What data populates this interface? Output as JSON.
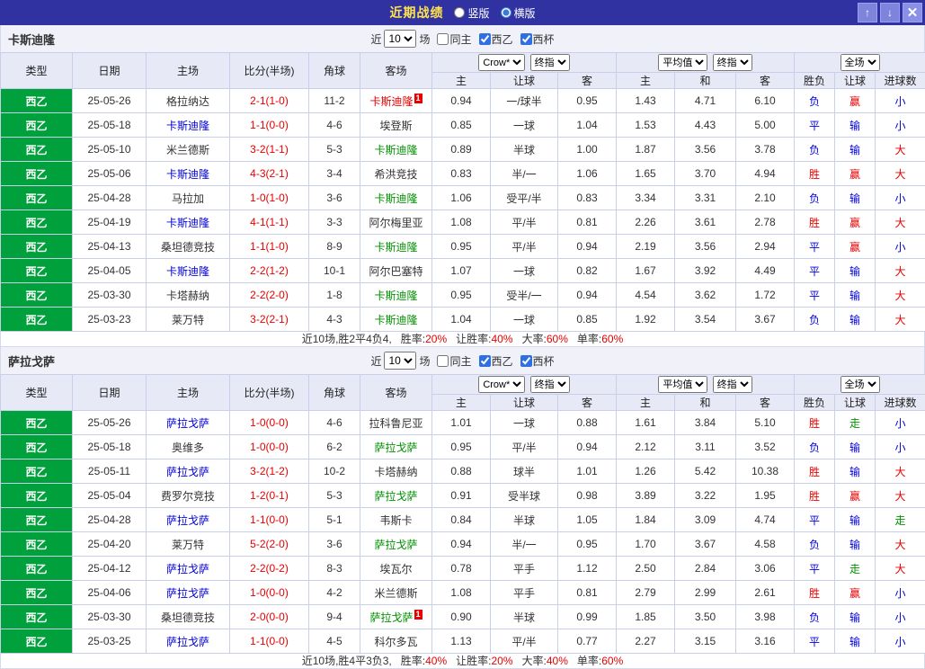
{
  "topbar": {
    "title": "近期战绩",
    "view_options": [
      {
        "label": "竖版",
        "selected": false
      },
      {
        "label": "横版",
        "selected": true
      }
    ],
    "up_label": "↑",
    "down_label": "↓",
    "close_label": "✕"
  },
  "colors": {
    "topbar_bg": "#3032a2",
    "league_cell_bg": "#00a13c",
    "positive_red": "#e60000",
    "negative_blue": "#0000d8",
    "push_green": "#009100",
    "home_team_blue": "#0000d8",
    "away_team_green": "#009100",
    "score_red": "#e60000",
    "header_bg": "#e8e9f6"
  },
  "table_headers": {
    "type": "类型",
    "date": "日期",
    "home": "主场",
    "score": "比分(半场)",
    "corner": "角球",
    "away": "客场",
    "odds_home": "主",
    "odds_handicap": "让球",
    "odds_away": "客",
    "avg_home": "主",
    "avg_draw": "和",
    "avg_away": "客",
    "result": "胜负",
    "handicap_result": "让球",
    "goals": "进球数"
  },
  "sections": [
    {
      "team": "卡斯迪隆",
      "filter": {
        "prefix": "近",
        "count": "10",
        "suffix": "场",
        "checkboxes": [
          {
            "label": "同主",
            "checked": false
          },
          {
            "label": "西乙",
            "checked": true
          },
          {
            "label": "西杯",
            "checked": true
          }
        ]
      },
      "selects": {
        "odds_source": "Crow*",
        "odds_final": "终指",
        "avg_source": "平均值",
        "avg_final": "终指",
        "scope": "全场"
      },
      "rows": [
        {
          "league": "西乙",
          "date": "25-05-26",
          "home": {
            "name": "格拉纳达",
            "color": "black"
          },
          "score": "2-1(1-0)",
          "corner": "11-2",
          "away": {
            "name": "卡斯迪隆",
            "color": "red",
            "badge": "1"
          },
          "odds": [
            "0.94",
            "一/球半",
            "0.95"
          ],
          "avg": [
            "1.43",
            "4.71",
            "6.10"
          ],
          "results": [
            {
              "text": "负",
              "color": "blue"
            },
            {
              "text": "赢",
              "color": "red"
            },
            {
              "text": "小",
              "color": "blue"
            }
          ]
        },
        {
          "league": "西乙",
          "date": "25-05-18",
          "home": {
            "name": "卡斯迪隆",
            "color": "blue"
          },
          "score": "1-1(0-0)",
          "corner": "4-6",
          "away": {
            "name": "埃登斯",
            "color": "black"
          },
          "odds": [
            "0.85",
            "一球",
            "1.04"
          ],
          "avg": [
            "1.53",
            "4.43",
            "5.00"
          ],
          "results": [
            {
              "text": "平",
              "color": "blue"
            },
            {
              "text": "输",
              "color": "blue"
            },
            {
              "text": "小",
              "color": "blue"
            }
          ]
        },
        {
          "league": "西乙",
          "date": "25-05-10",
          "home": {
            "name": "米兰德斯",
            "color": "black"
          },
          "score": "3-2(1-1)",
          "corner": "5-3",
          "away": {
            "name": "卡斯迪隆",
            "color": "green"
          },
          "odds": [
            "0.89",
            "半球",
            "1.00"
          ],
          "avg": [
            "1.87",
            "3.56",
            "3.78"
          ],
          "results": [
            {
              "text": "负",
              "color": "blue"
            },
            {
              "text": "输",
              "color": "blue"
            },
            {
              "text": "大",
              "color": "red"
            }
          ]
        },
        {
          "league": "西乙",
          "date": "25-05-06",
          "home": {
            "name": "卡斯迪隆",
            "color": "blue"
          },
          "score": "4-3(2-1)",
          "corner": "3-4",
          "away": {
            "name": "希洪竞技",
            "color": "black"
          },
          "odds": [
            "0.83",
            "半/一",
            "1.06"
          ],
          "avg": [
            "1.65",
            "3.70",
            "4.94"
          ],
          "results": [
            {
              "text": "胜",
              "color": "red"
            },
            {
              "text": "赢",
              "color": "red"
            },
            {
              "text": "大",
              "color": "red"
            }
          ]
        },
        {
          "league": "西乙",
          "date": "25-04-28",
          "home": {
            "name": "马拉加",
            "color": "black"
          },
          "score": "1-0(1-0)",
          "corner": "3-6",
          "away": {
            "name": "卡斯迪隆",
            "color": "green"
          },
          "odds": [
            "1.06",
            "受平/半",
            "0.83"
          ],
          "avg": [
            "3.34",
            "3.31",
            "2.10"
          ],
          "results": [
            {
              "text": "负",
              "color": "blue"
            },
            {
              "text": "输",
              "color": "blue"
            },
            {
              "text": "小",
              "color": "blue"
            }
          ]
        },
        {
          "league": "西乙",
          "date": "25-04-19",
          "home": {
            "name": "卡斯迪隆",
            "color": "blue"
          },
          "score": "4-1(1-1)",
          "corner": "3-3",
          "away": {
            "name": "阿尔梅里亚",
            "color": "black"
          },
          "odds": [
            "1.08",
            "平/半",
            "0.81"
          ],
          "avg": [
            "2.26",
            "3.61",
            "2.78"
          ],
          "results": [
            {
              "text": "胜",
              "color": "red"
            },
            {
              "text": "赢",
              "color": "red"
            },
            {
              "text": "大",
              "color": "red"
            }
          ]
        },
        {
          "league": "西乙",
          "date": "25-04-13",
          "home": {
            "name": "桑坦德竞技",
            "color": "black"
          },
          "score": "1-1(1-0)",
          "corner": "8-9",
          "away": {
            "name": "卡斯迪隆",
            "color": "green"
          },
          "odds": [
            "0.95",
            "平/半",
            "0.94"
          ],
          "avg": [
            "2.19",
            "3.56",
            "2.94"
          ],
          "results": [
            {
              "text": "平",
              "color": "blue"
            },
            {
              "text": "赢",
              "color": "red"
            },
            {
              "text": "小",
              "color": "blue"
            }
          ]
        },
        {
          "league": "西乙",
          "date": "25-04-05",
          "home": {
            "name": "卡斯迪隆",
            "color": "blue"
          },
          "score": "2-2(1-2)",
          "corner": "10-1",
          "away": {
            "name": "阿尔巴塞特",
            "color": "black"
          },
          "odds": [
            "1.07",
            "一球",
            "0.82"
          ],
          "avg": [
            "1.67",
            "3.92",
            "4.49"
          ],
          "results": [
            {
              "text": "平",
              "color": "blue"
            },
            {
              "text": "输",
              "color": "blue"
            },
            {
              "text": "大",
              "color": "red"
            }
          ]
        },
        {
          "league": "西乙",
          "date": "25-03-30",
          "home": {
            "name": "卡塔赫纳",
            "color": "black"
          },
          "score": "2-2(2-0)",
          "corner": "1-8",
          "away": {
            "name": "卡斯迪隆",
            "color": "green"
          },
          "odds": [
            "0.95",
            "受半/一",
            "0.94"
          ],
          "avg": [
            "4.54",
            "3.62",
            "1.72"
          ],
          "results": [
            {
              "text": "平",
              "color": "blue"
            },
            {
              "text": "输",
              "color": "blue"
            },
            {
              "text": "大",
              "color": "red"
            }
          ]
        },
        {
          "league": "西乙",
          "date": "25-03-23",
          "home": {
            "name": "莱万特",
            "color": "black"
          },
          "score": "3-2(2-1)",
          "corner": "4-3",
          "away": {
            "name": "卡斯迪隆",
            "color": "green"
          },
          "odds": [
            "1.04",
            "一球",
            "0.85"
          ],
          "avg": [
            "1.92",
            "3.54",
            "3.67"
          ],
          "results": [
            {
              "text": "负",
              "color": "blue"
            },
            {
              "text": "输",
              "color": "blue"
            },
            {
              "text": "大",
              "color": "red"
            }
          ]
        }
      ],
      "summary": {
        "prefix": "近10场,胜2平4负4,",
        "stats": [
          {
            "label": "胜率:",
            "value": "20%"
          },
          {
            "label": "让胜率:",
            "value": "40%"
          },
          {
            "label": "大率:",
            "value": "60%"
          },
          {
            "label": "单率:",
            "value": "60%"
          }
        ]
      }
    },
    {
      "team": "萨拉戈萨",
      "filter": {
        "prefix": "近",
        "count": "10",
        "suffix": "场",
        "checkboxes": [
          {
            "label": "同主",
            "checked": false
          },
          {
            "label": "西乙",
            "checked": true
          },
          {
            "label": "西杯",
            "checked": true
          }
        ]
      },
      "selects": {
        "odds_source": "Crow*",
        "odds_final": "终指",
        "avg_source": "平均值",
        "avg_final": "终指",
        "scope": "全场"
      },
      "rows": [
        {
          "league": "西乙",
          "date": "25-05-26",
          "home": {
            "name": "萨拉戈萨",
            "color": "blue"
          },
          "score": "1-0(0-0)",
          "corner": "4-6",
          "away": {
            "name": "拉科鲁尼亚",
            "color": "black"
          },
          "odds": [
            "1.01",
            "一球",
            "0.88"
          ],
          "avg": [
            "1.61",
            "3.84",
            "5.10"
          ],
          "results": [
            {
              "text": "胜",
              "color": "red"
            },
            {
              "text": "走",
              "color": "green"
            },
            {
              "text": "小",
              "color": "blue"
            }
          ]
        },
        {
          "league": "西乙",
          "date": "25-05-18",
          "home": {
            "name": "奥维多",
            "color": "black"
          },
          "score": "1-0(0-0)",
          "corner": "6-2",
          "away": {
            "name": "萨拉戈萨",
            "color": "green"
          },
          "odds": [
            "0.95",
            "平/半",
            "0.94"
          ],
          "avg": [
            "2.12",
            "3.11",
            "3.52"
          ],
          "results": [
            {
              "text": "负",
              "color": "blue"
            },
            {
              "text": "输",
              "color": "blue"
            },
            {
              "text": "小",
              "color": "blue"
            }
          ]
        },
        {
          "league": "西乙",
          "date": "25-05-11",
          "home": {
            "name": "萨拉戈萨",
            "color": "blue"
          },
          "score": "3-2(1-2)",
          "corner": "10-2",
          "away": {
            "name": "卡塔赫纳",
            "color": "black"
          },
          "odds": [
            "0.88",
            "球半",
            "1.01"
          ],
          "avg": [
            "1.26",
            "5.42",
            "10.38"
          ],
          "results": [
            {
              "text": "胜",
              "color": "red"
            },
            {
              "text": "输",
              "color": "blue"
            },
            {
              "text": "大",
              "color": "red"
            }
          ]
        },
        {
          "league": "西乙",
          "date": "25-05-04",
          "home": {
            "name": "费罗尔竞技",
            "color": "black"
          },
          "score": "1-2(0-1)",
          "corner": "5-3",
          "away": {
            "name": "萨拉戈萨",
            "color": "green"
          },
          "odds": [
            "0.91",
            "受半球",
            "0.98"
          ],
          "avg": [
            "3.89",
            "3.22",
            "1.95"
          ],
          "results": [
            {
              "text": "胜",
              "color": "red"
            },
            {
              "text": "赢",
              "color": "red"
            },
            {
              "text": "大",
              "color": "red"
            }
          ]
        },
        {
          "league": "西乙",
          "date": "25-04-28",
          "home": {
            "name": "萨拉戈萨",
            "color": "blue"
          },
          "score": "1-1(0-0)",
          "corner": "5-1",
          "away": {
            "name": "韦斯卡",
            "color": "black"
          },
          "odds": [
            "0.84",
            "半球",
            "1.05"
          ],
          "avg": [
            "1.84",
            "3.09",
            "4.74"
          ],
          "results": [
            {
              "text": "平",
              "color": "blue"
            },
            {
              "text": "输",
              "color": "blue"
            },
            {
              "text": "走",
              "color": "green"
            }
          ]
        },
        {
          "league": "西乙",
          "date": "25-04-20",
          "home": {
            "name": "莱万特",
            "color": "black"
          },
          "score": "5-2(2-0)",
          "corner": "3-6",
          "away": {
            "name": "萨拉戈萨",
            "color": "green"
          },
          "odds": [
            "0.94",
            "半/一",
            "0.95"
          ],
          "avg": [
            "1.70",
            "3.67",
            "4.58"
          ],
          "results": [
            {
              "text": "负",
              "color": "blue"
            },
            {
              "text": "输",
              "color": "blue"
            },
            {
              "text": "大",
              "color": "red"
            }
          ]
        },
        {
          "league": "西乙",
          "date": "25-04-12",
          "home": {
            "name": "萨拉戈萨",
            "color": "blue"
          },
          "score": "2-2(0-2)",
          "corner": "8-3",
          "away": {
            "name": "埃瓦尔",
            "color": "black"
          },
          "odds": [
            "0.78",
            "平手",
            "1.12"
          ],
          "avg": [
            "2.50",
            "2.84",
            "3.06"
          ],
          "results": [
            {
              "text": "平",
              "color": "blue"
            },
            {
              "text": "走",
              "color": "green"
            },
            {
              "text": "大",
              "color": "red"
            }
          ]
        },
        {
          "league": "西乙",
          "date": "25-04-06",
          "home": {
            "name": "萨拉戈萨",
            "color": "blue"
          },
          "score": "1-0(0-0)",
          "corner": "4-2",
          "away": {
            "name": "米兰德斯",
            "color": "black"
          },
          "odds": [
            "1.08",
            "平手",
            "0.81"
          ],
          "avg": [
            "2.79",
            "2.99",
            "2.61"
          ],
          "results": [
            {
              "text": "胜",
              "color": "red"
            },
            {
              "text": "赢",
              "color": "red"
            },
            {
              "text": "小",
              "color": "blue"
            }
          ]
        },
        {
          "league": "西乙",
          "date": "25-03-30",
          "home": {
            "name": "桑坦德竞技",
            "color": "black"
          },
          "score": "2-0(0-0)",
          "corner": "9-4",
          "away": {
            "name": "萨拉戈萨",
            "color": "green",
            "badge": "1"
          },
          "odds": [
            "0.90",
            "半球",
            "0.99"
          ],
          "avg": [
            "1.85",
            "3.50",
            "3.98"
          ],
          "results": [
            {
              "text": "负",
              "color": "blue"
            },
            {
              "text": "输",
              "color": "blue"
            },
            {
              "text": "小",
              "color": "blue"
            }
          ]
        },
        {
          "league": "西乙",
          "date": "25-03-25",
          "home": {
            "name": "萨拉戈萨",
            "color": "blue"
          },
          "score": "1-1(0-0)",
          "corner": "4-5",
          "away": {
            "name": "科尔多瓦",
            "color": "black"
          },
          "odds": [
            "1.13",
            "平/半",
            "0.77"
          ],
          "avg": [
            "2.27",
            "3.15",
            "3.16"
          ],
          "results": [
            {
              "text": "平",
              "color": "blue"
            },
            {
              "text": "输",
              "color": "blue"
            },
            {
              "text": "小",
              "color": "blue"
            }
          ]
        }
      ],
      "summary": {
        "prefix": "近10场,胜4平3负3,",
        "stats": [
          {
            "label": "胜率:",
            "value": "40%"
          },
          {
            "label": "让胜率:",
            "value": "20%"
          },
          {
            "label": "大率:",
            "value": "40%"
          },
          {
            "label": "单率:",
            "value": "60%"
          }
        ]
      }
    }
  ]
}
